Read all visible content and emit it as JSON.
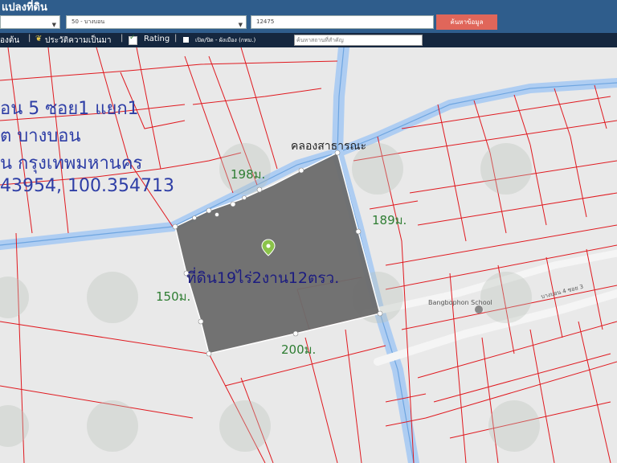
{
  "app": {
    "title": "แปลงที่ดิน"
  },
  "search": {
    "district_select": "50 - บางบอน",
    "parcel_number": "12475",
    "search_button": "ค้นหาข้อมูล"
  },
  "toolbar": {
    "item1": "องต้น",
    "history": "ประวัติความเป็นมา",
    "rating": "Rating",
    "toggle": "เปิด/ปิด - ผังเมือง (กทม.)",
    "landmark_placeholder": "ค้นหาสถานที่สำคัญ"
  },
  "map": {
    "info_lines": [
      "อน 5 ซอย1 แยก1",
      "ต บางบอน",
      "น กรุงเทพมหานคร",
      "43954, 100.354713"
    ],
    "canal_label": "คลองสาธารณะ",
    "plot_area": "ที่ดิน19ไร่2งาน12ตรว.",
    "measurements": {
      "north": "198ม.",
      "east": "189ม.",
      "west": "150ม.",
      "south": "200ม."
    },
    "school_label": "Bangbophon School",
    "road_label": "บางบอน 4 ซอย 3"
  },
  "colors": {
    "parcel_line": "#e0191f",
    "plot_fill": "#6b6b6b",
    "canal": "#aecdf2",
    "header": "#2f5d8c",
    "toolbar": "#15273f"
  }
}
